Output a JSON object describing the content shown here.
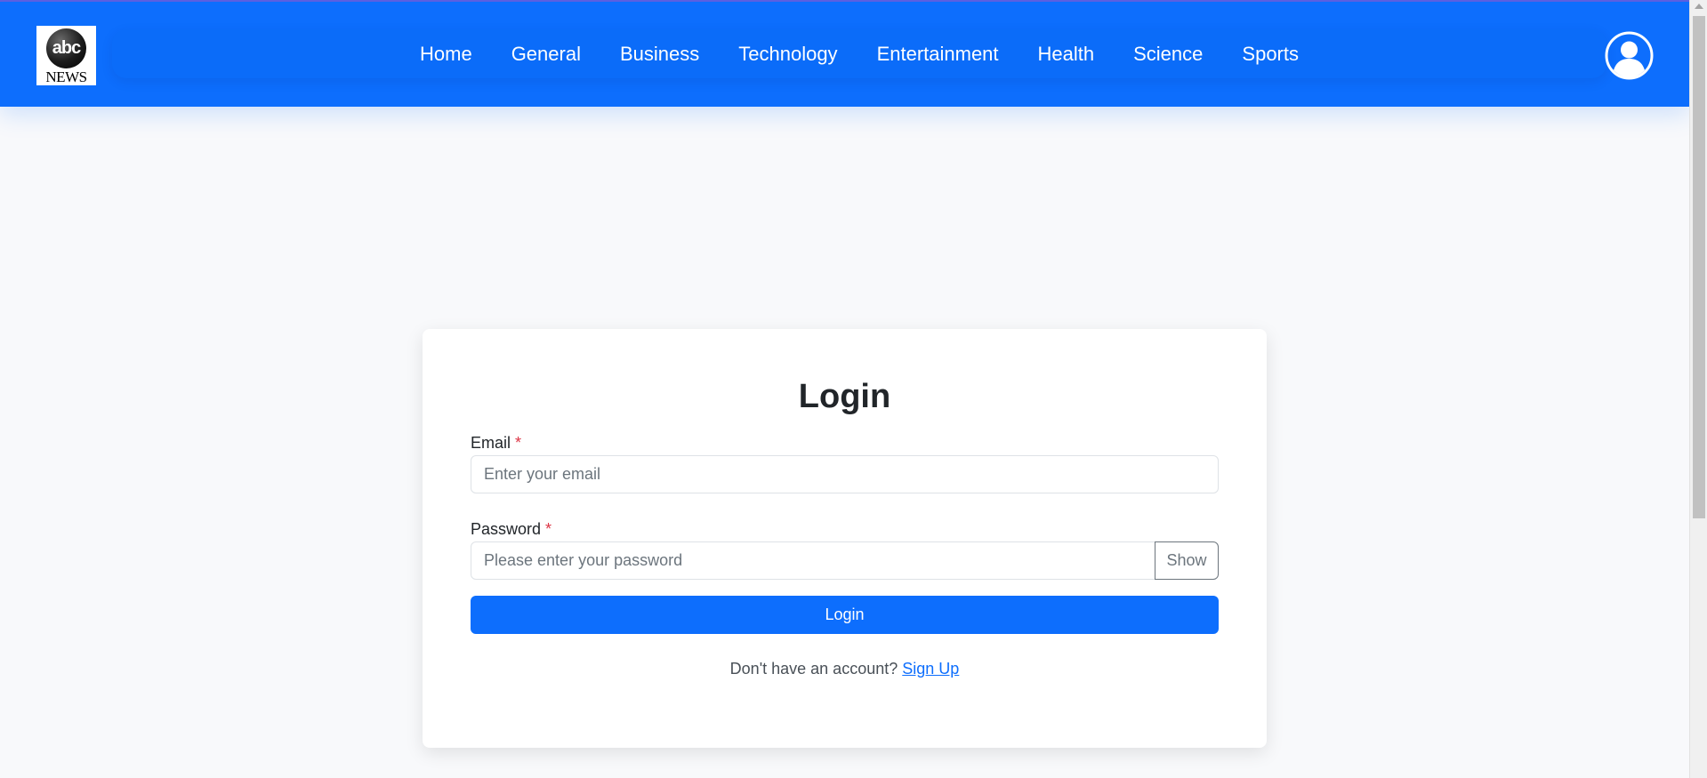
{
  "header": {
    "logo": {
      "top_text": "abc",
      "bottom_text": "NEWS"
    },
    "nav_links": [
      {
        "label": "Home"
      },
      {
        "label": "General"
      },
      {
        "label": "Business"
      },
      {
        "label": "Technology"
      },
      {
        "label": "Entertainment"
      },
      {
        "label": "Health"
      },
      {
        "label": "Science"
      },
      {
        "label": "Sports"
      }
    ],
    "avatar_icon": "user-circle-icon",
    "background_color": "#0d6efd"
  },
  "login_form": {
    "title": "Login",
    "email": {
      "label": "Email",
      "required_mark": "*",
      "placeholder": "Enter your email",
      "value": ""
    },
    "password": {
      "label": "Password",
      "required_mark": "*",
      "placeholder": "Please enter your password",
      "value": "",
      "toggle_label": "Show"
    },
    "submit_label": "Login",
    "signup_prompt": "Don't have an account?",
    "signup_link": "Sign Up",
    "accent_color": "#0d6efd"
  }
}
